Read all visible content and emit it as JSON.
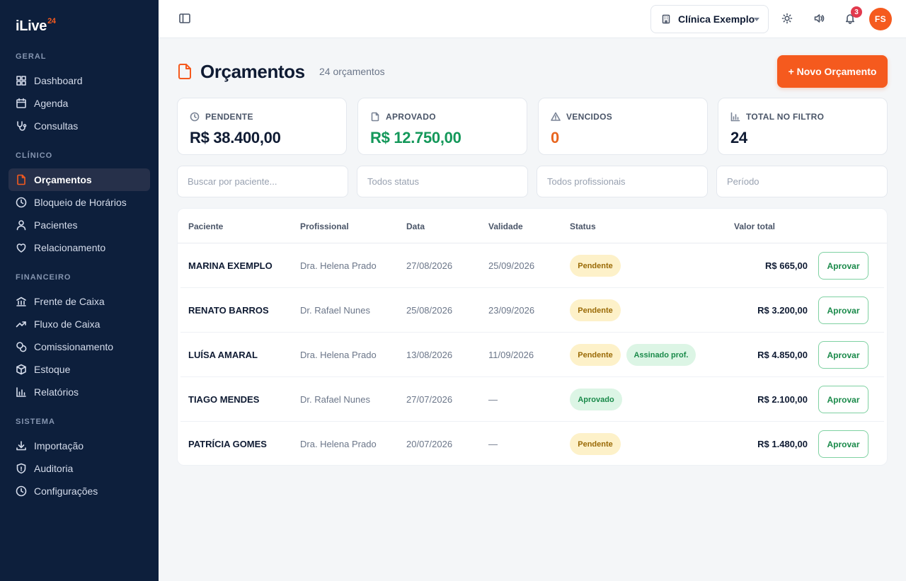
{
  "app": {
    "logo_text": "iLive",
    "logo_sup": "24"
  },
  "sidebar": {
    "sections": {
      "geral": "GERAL",
      "clinico": "CLÍNICO",
      "financeiro": "FINANCEIRO",
      "sistema": "SISTEMA"
    },
    "items": [
      {
        "label": "Dashboard",
        "icon": "dashboard-icon"
      },
      {
        "label": "Agenda",
        "icon": "calendar-icon"
      },
      {
        "label": "Consultas",
        "icon": "stethoscope-icon"
      },
      {
        "label": "Orçamentos",
        "icon": "file-icon",
        "active": true
      },
      {
        "label": "Bloqueio de Horários",
        "icon": "clock-icon"
      },
      {
        "label": "Pacientes",
        "icon": "user-icon"
      },
      {
        "label": "Relacionamento",
        "icon": "heart-icon"
      },
      {
        "label": "Frente de Caixa",
        "icon": "bank-icon"
      },
      {
        "label": "Fluxo de Caixa",
        "icon": "trending-icon"
      },
      {
        "label": "Comissionamento",
        "icon": "coins-icon"
      },
      {
        "label": "Estoque",
        "icon": "box-icon"
      },
      {
        "label": "Relatórios",
        "icon": "chart-icon"
      },
      {
        "label": "Importação",
        "icon": "download-icon"
      },
      {
        "label": "Auditoria",
        "icon": "shield-icon"
      },
      {
        "label": "Configurações",
        "icon": "clock-icon"
      }
    ]
  },
  "topbar": {
    "clinic": "Clínica Exemplo",
    "notifications_count": "3",
    "avatar_initials": "FS"
  },
  "header": {
    "title": "Orçamentos",
    "count": "24 orçamentos",
    "new_button": "+ Novo Orçamento"
  },
  "stats": [
    {
      "label": "PENDENTE",
      "value": "R$ 38.400,00",
      "icon": "clock-icon",
      "color": "#0f1b33"
    },
    {
      "label": "APROVADO",
      "value": "R$ 12.750,00",
      "icon": "file-icon",
      "color": "#14985a"
    },
    {
      "label": "VENCIDOS",
      "value": "0",
      "icon": "warning-icon",
      "color": "#e8651f"
    },
    {
      "label": "TOTAL NO FILTRO",
      "value": "24",
      "icon": "bar-chart-icon",
      "color": "#0f1b33"
    }
  ],
  "filters": {
    "search_placeholder": "Buscar por paciente...",
    "status": "Todos status",
    "professional": "Todos profissionais",
    "period": "Período"
  },
  "table": {
    "columns": [
      "Paciente",
      "Profissional",
      "Data",
      "Validade",
      "Status",
      "Valor total"
    ],
    "approve_label": "Aprovar",
    "rows": [
      {
        "patient": "MARINA EXEMPLO",
        "professional": "Dra. Helena Prado",
        "date": "27/08/2026",
        "validity": "25/09/2026",
        "status": "Pendente",
        "extra_status": "",
        "value": "R$ 665,00"
      },
      {
        "patient": "RENATO BARROS",
        "professional": "Dr. Rafael Nunes",
        "date": "25/08/2026",
        "validity": "23/09/2026",
        "status": "Pendente",
        "extra_status": "",
        "value": "R$ 3.200,00"
      },
      {
        "patient": "LUÍSA AMARAL",
        "professional": "Dra. Helena Prado",
        "date": "13/08/2026",
        "validity": "11/09/2026",
        "status": "Pendente",
        "extra_status": "Assinado prof.",
        "value": "R$ 4.850,00"
      },
      {
        "patient": "TIAGO MENDES",
        "professional": "Dr. Rafael Nunes",
        "date": "27/07/2026",
        "validity": "—",
        "status": "Aprovado",
        "extra_status": "",
        "value": "R$ 2.100,00"
      },
      {
        "patient": "PATRÍCIA GOMES",
        "professional": "Dra. Helena Prado",
        "date": "20/07/2026",
        "validity": "—",
        "status": "Pendente",
        "extra_status": "",
        "value": "R$ 1.480,00"
      }
    ]
  }
}
